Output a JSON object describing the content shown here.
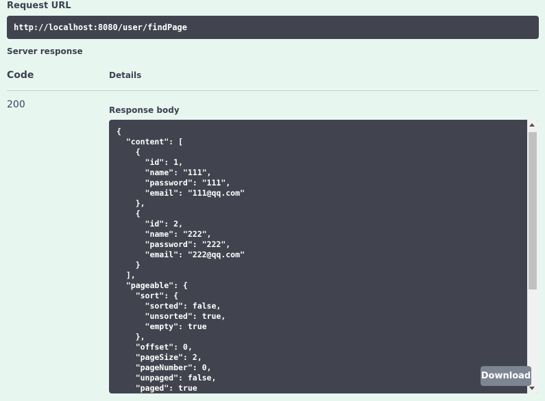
{
  "request_url": {
    "label": "Request URL",
    "value": "http://localhost:8080/user/findPage"
  },
  "server_response": {
    "label": "Server response",
    "table_headers": {
      "code": "Code",
      "details": "Details"
    },
    "code": "200",
    "response_body_label": "Response body",
    "response_body": "{\n  \"content\": [\n    {\n      \"id\": 1,\n      \"name\": \"111\",\n      \"password\": \"111\",\n      \"email\": \"111@qq.com\"\n    },\n    {\n      \"id\": 2,\n      \"name\": \"222\",\n      \"password\": \"222\",\n      \"email\": \"222@qq.com\"\n    }\n  ],\n  \"pageable\": {\n    \"sort\": {\n      \"sorted\": false,\n      \"unsorted\": true,\n      \"empty\": true\n    },\n    \"offset\": 0,\n    \"pageSize\": 2,\n    \"pageNumber\": 0,\n    \"unpaged\": false,\n    \"paged\": true",
    "download_label": "Download"
  },
  "colors": {
    "page_background": "#e8f6f0",
    "code_background": "#41444e",
    "download_button": "#7d8492",
    "text": "#3b4151"
  }
}
